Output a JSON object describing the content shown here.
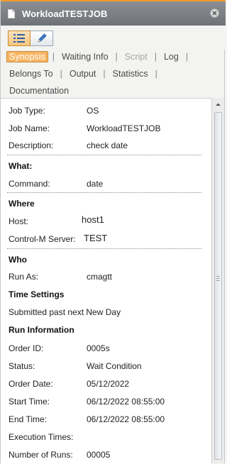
{
  "window": {
    "title": "WorkloadTESTJOB"
  },
  "tabs": {
    "row1": [
      {
        "label": "Synopsis",
        "state": "selected"
      },
      {
        "label": "Waiting Info",
        "state": "normal"
      },
      {
        "label": "Script",
        "state": "disabled"
      },
      {
        "label": "Log",
        "state": "normal"
      }
    ],
    "row2": [
      {
        "label": "Belongs To",
        "state": "normal"
      },
      {
        "label": "Output",
        "state": "normal"
      },
      {
        "label": "Statistics",
        "state": "normal"
      }
    ],
    "row3": [
      {
        "label": "Documentation",
        "state": "normal"
      }
    ],
    "separator": "|"
  },
  "details": {
    "job_type_label": "Job Type:",
    "job_type": "OS",
    "job_name_label": "Job Name:",
    "job_name": "WorkloadTESTJOB",
    "description_label": "Description:",
    "description": "check date",
    "what_header": "What:",
    "command_label": "Command:",
    "command": "date",
    "where_header": "Where",
    "host_label": "Host:",
    "host": "host1",
    "server_label": "Control-M Server:",
    "server": "TEST",
    "who_header": "Who",
    "run_as_label": "Run As:",
    "run_as": "cmagtt",
    "time_header": "Time Settings",
    "time_text": "Submitted past next New Day",
    "run_header": "Run Information",
    "order_id_label": "Order ID:",
    "order_id": "0005s",
    "status_label": "Status:",
    "status": "Wait Condition",
    "order_date_label": "Order Date:",
    "order_date": "05/12/2022",
    "start_label": "Start Time:",
    "start": "06/12/2022 08:55:00",
    "end_label": "End Time:",
    "end": "06/12/2022 08:55:00",
    "exec_label": "Execution Times:",
    "exec": "",
    "runs_label": "Number of Runs:",
    "runs": "00005"
  },
  "colors": {
    "accent": "#f6b562",
    "titlebar": "#7d8185",
    "top_line": "#f29a2e"
  }
}
